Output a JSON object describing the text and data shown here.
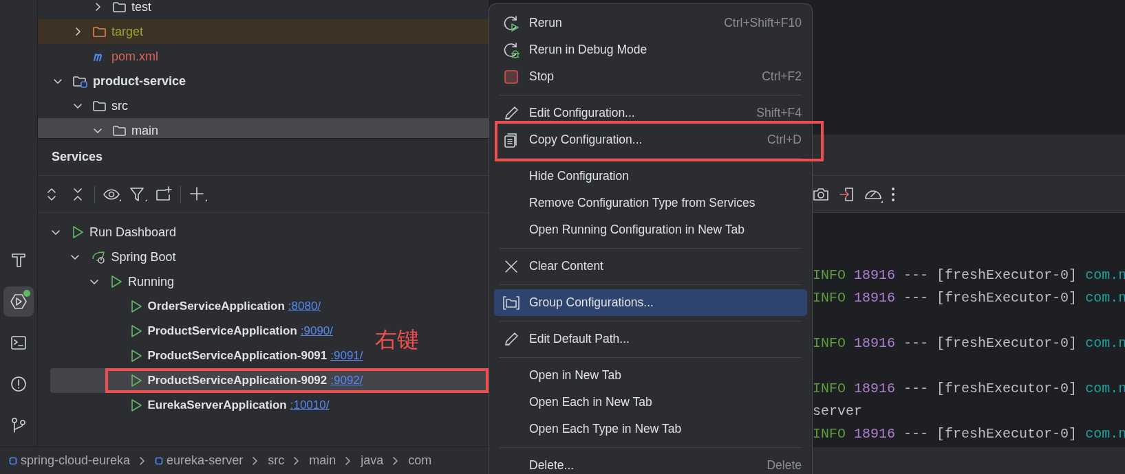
{
  "tool_window_bar": {
    "items": [
      {
        "kind": "build",
        "selected": false
      },
      {
        "kind": "services",
        "selected": true,
        "notification": true
      },
      {
        "kind": "terminal",
        "selected": false
      },
      {
        "kind": "problems",
        "selected": false
      },
      {
        "kind": "git",
        "selected": false
      }
    ]
  },
  "project_tree": {
    "items": [
      {
        "children": [
          {
            "children": [
              {
                "label": "test",
                "kind": "folder",
                "expanded": false,
                "selected": false
              }
            ]
          },
          {
            "label": "target",
            "kind": "excluded",
            "expanded": false,
            "selected": false,
            "color": "#a3a136"
          },
          {
            "label": "pom.xml",
            "kind": "maven",
            "selected": false,
            "color": "#d8645a"
          }
        ]
      },
      {
        "label": "product-service",
        "kind": "module",
        "expanded": true,
        "selected": false,
        "children": [
          {
            "label": "src",
            "kind": "folder",
            "expanded": true,
            "selected": false,
            "children": [
              {
                "label": "main",
                "kind": "folder",
                "expanded": true,
                "selected": true
              }
            ]
          }
        ]
      }
    ]
  },
  "services": {
    "title": "Services",
    "toolbar": [
      {
        "kind": "expand"
      },
      {
        "kind": "collapse"
      },
      {
        "kind": "separator"
      },
      {
        "kind": "view"
      },
      {
        "kind": "filter"
      },
      {
        "kind": "new-tab"
      },
      {
        "kind": "separator"
      },
      {
        "kind": "add"
      }
    ],
    "tree": [
      {
        "label": "Run Dashboard",
        "kind": "run",
        "expanded": true,
        "selected": false,
        "children": [
          {
            "label": "Spring Boot",
            "kind": "spring",
            "expanded": true,
            "selected": false,
            "children": [
              {
                "label": "Running",
                "kind": "run",
                "expanded": true,
                "selected": false,
                "children": [
                  {
                    "label": "OrderServiceApplication",
                    "kind": "app",
                    "port": ":8080/",
                    "selected": false,
                    "outlined": false
                  },
                  {
                    "label": "ProductServiceApplication",
                    "kind": "app",
                    "port": ":9090/",
                    "selected": false,
                    "outlined": false
                  },
                  {
                    "label": "ProductServiceApplication-9091",
                    "kind": "app",
                    "port": ":9091/",
                    "selected": false,
                    "outlined": false
                  },
                  {
                    "label": "ProductServiceApplication-9092",
                    "kind": "app",
                    "port": ":9092/",
                    "selected": true,
                    "outlined": true
                  },
                  {
                    "label": "EurekaServerApplication",
                    "kind": "app",
                    "port": ":10010/",
                    "selected": false,
                    "outlined": false
                  }
                ]
              }
            ]
          }
        ]
      }
    ],
    "annotation": "右键"
  },
  "console": {
    "toolbar": [
      {
        "kind": "screenshot"
      },
      {
        "kind": "exit"
      },
      {
        "kind": "gauge"
      },
      {
        "kind": "more"
      }
    ],
    "lines": [
      {
        "kind": "log",
        "level": "INFO",
        "pid": "18916",
        "thread": "--- [freshExecutor-0]",
        "logger": "com.n"
      },
      {
        "kind": "log",
        "level": "INFO",
        "pid": "18916",
        "thread": "--- [freshExecutor-0]",
        "logger": "com.n"
      },
      {
        "kind": "blank"
      },
      {
        "kind": "log",
        "level": "INFO",
        "pid": "18916",
        "thread": "--- [freshExecutor-0]",
        "logger": "com.n"
      },
      {
        "kind": "blank"
      },
      {
        "kind": "log",
        "level": "INFO",
        "pid": "18916",
        "thread": "--- [freshExecutor-0]",
        "logger": "com.n"
      },
      {
        "kind": "text",
        "text": "server"
      },
      {
        "kind": "log",
        "level": "INFO",
        "pid": "18916",
        "thread": "--- [freshExecutor-0]",
        "logger": "com.n"
      }
    ]
  },
  "context_menu": {
    "items": [
      {
        "kind": "rerun",
        "label": "Rerun",
        "shortcut": "Ctrl+Shift+F10",
        "selected": false,
        "outlined": false
      },
      {
        "kind": "debug",
        "label": "Rerun in Debug Mode",
        "selected": false,
        "outlined": false
      },
      {
        "kind": "stop",
        "label": "Stop",
        "shortcut": "Ctrl+F2",
        "selected": false,
        "outlined": false
      },
      {
        "kind": "separator"
      },
      {
        "kind": "edit",
        "label": "Edit Configuration...",
        "shortcut": "Shift+F4",
        "selected": false,
        "outlined": false
      },
      {
        "kind": "copy",
        "label": "Copy Configuration...",
        "shortcut": "Ctrl+D",
        "selected": false,
        "outlined": true
      },
      {
        "kind": "separator"
      },
      {
        "kind": "plain",
        "label": "Hide Configuration",
        "selected": false,
        "outlined": false
      },
      {
        "kind": "plain",
        "label": "Remove Configuration Type from Services",
        "selected": false,
        "outlined": false
      },
      {
        "kind": "plain",
        "label": "Open Running Configuration in New Tab",
        "selected": false,
        "outlined": false
      },
      {
        "kind": "separator"
      },
      {
        "kind": "clear",
        "label": "Clear Content",
        "selected": false,
        "outlined": false
      },
      {
        "kind": "separator"
      },
      {
        "kind": "group",
        "label": "Group Configurations...",
        "selected": true,
        "outlined": false
      },
      {
        "kind": "separator"
      },
      {
        "kind": "edit",
        "label": "Edit Default Path...",
        "selected": false,
        "outlined": false
      },
      {
        "kind": "separator"
      },
      {
        "kind": "plain",
        "label": "Open in New Tab",
        "selected": false,
        "outlined": false
      },
      {
        "kind": "plain",
        "label": "Open Each in New Tab",
        "selected": false,
        "outlined": false
      },
      {
        "kind": "plain",
        "label": "Open Each Type in New Tab",
        "selected": false,
        "outlined": false
      },
      {
        "kind": "separator"
      },
      {
        "kind": "plain",
        "label": "Delete...",
        "shortcut": "Delete",
        "selected": false,
        "outlined": false
      }
    ]
  },
  "breadcrumbs": [
    {
      "label": "spring-cloud-eureka",
      "kind": "module"
    },
    {
      "label": "eureka-server",
      "kind": "module"
    },
    {
      "label": "src",
      "kind": "folder"
    },
    {
      "label": "main",
      "kind": "folder"
    },
    {
      "label": "java",
      "kind": "folder"
    },
    {
      "label": "com",
      "kind": "folder"
    }
  ]
}
